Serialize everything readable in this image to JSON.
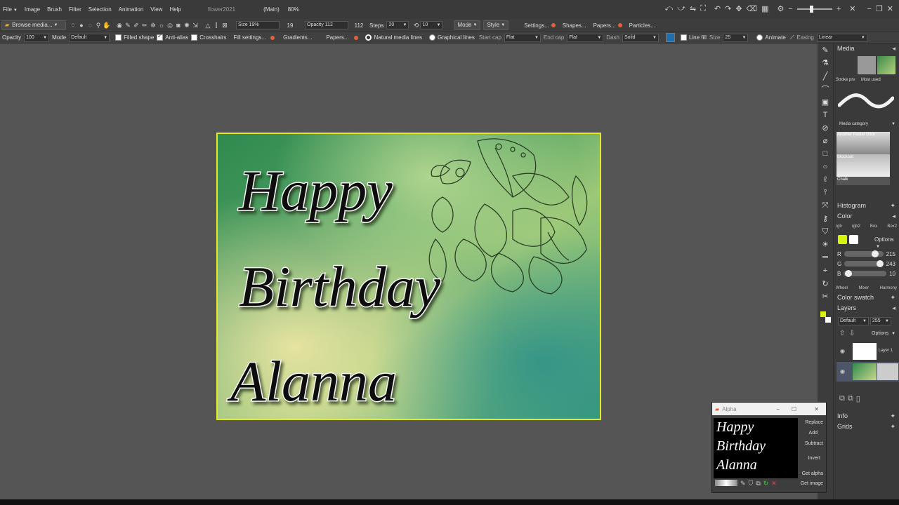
{
  "menubar": {
    "items": [
      "File",
      "Image",
      "Brush",
      "Filter",
      "Selection",
      "Animation",
      "View",
      "Help"
    ],
    "doc_title": "flower2021",
    "doc_layer": "(Main)",
    "zoom": "80%"
  },
  "toolbar": {
    "browse_label": "Browse media...",
    "size_label": "Size 19%",
    "size_value": "19",
    "opacity_label": "Opacity 112",
    "opacity_value": "112",
    "steps_label": "Steps",
    "steps_value": "20",
    "count_value": "10",
    "mode_label": "Mode",
    "style_label": "Style",
    "settings_label": "Settings...",
    "shapes_label": "Shapes...",
    "papers_label": "Papers...",
    "particles_label": "Particles..."
  },
  "options": {
    "opacity_label": "Opacity",
    "opacity_value": "100",
    "mode_label": "Mode",
    "mode_value": "Default",
    "filled_shape": "Filled shape",
    "anti_alias": "Anti-alias",
    "crosshairs": "Crosshairs",
    "fill_settings": "Fill settings...",
    "gradients": "Gradients...",
    "papers": "Papers...",
    "natural_media": "Natural media lines",
    "graphical_lines": "Graphical lines",
    "start_cap_label": "Start cap",
    "start_cap_value": "Flat",
    "end_cap_label": "End cap",
    "end_cap_value": "Flat",
    "dash_label": "Dash",
    "dash_value": "Solid",
    "line_fill": "Line fill",
    "size_label": "Size",
    "size_value": "25",
    "animate": "Animate",
    "easing_label": "Easing",
    "easing_value": "Linear",
    "line_color": "#1e6fb0"
  },
  "card": {
    "line1": "Happy",
    "line2": "Birthday",
    "line3": "Alanna"
  },
  "panel": {
    "media_title": "Media",
    "stroke_prv": "Stroke prv",
    "most_used": "Most used",
    "media_category": "Media category",
    "media_items": [
      "Another Pastel Stick",
      "Blockout",
      "Chalk"
    ],
    "histogram_title": "Histogram",
    "color_title": "Color",
    "color_tabs": [
      "rgb",
      "rgb2",
      "Box",
      "Box2"
    ],
    "options_label": "Options",
    "r_label": "R",
    "r_value": "215",
    "g_label": "G",
    "g_value": "243",
    "b_label": "B",
    "b_value": "10",
    "color_subtabs": [
      "Wheel",
      "Mixer",
      "Harmony"
    ],
    "swatch_title": "Color swatch",
    "layers_title": "Layers",
    "layers_mode": "Default",
    "layers_opacity": "255",
    "layers_options": "Options",
    "layer1_name": "Layer 1",
    "info_title": "Info",
    "grids_title": "Grids",
    "fg_color": "#d7f30a",
    "bg_color": "#ffffff"
  },
  "alpha": {
    "title": "Alpha",
    "buttons": [
      "Replace",
      "Add",
      "Subtract",
      "Invert",
      "Get alpha",
      "Get image"
    ],
    "preview_lines": [
      "Happy",
      "Birthday",
      "Alanna"
    ]
  }
}
